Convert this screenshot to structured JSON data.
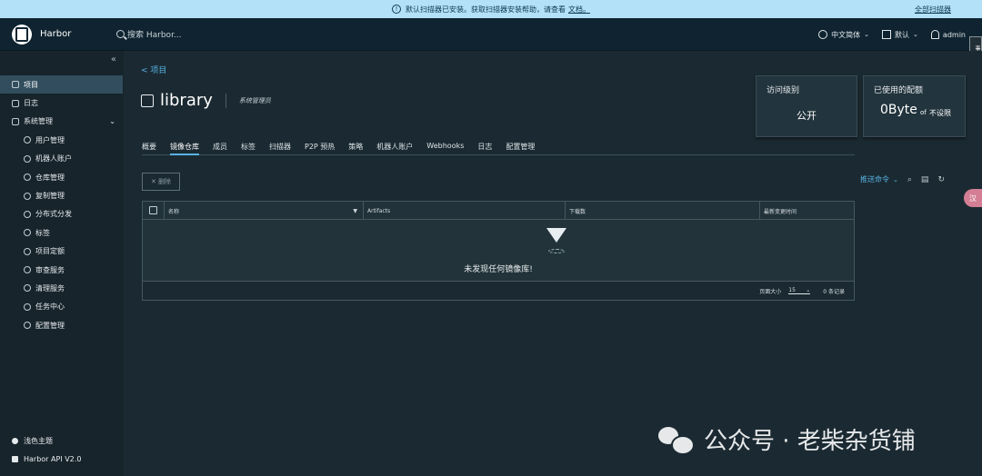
{
  "alert": {
    "text": "默认扫描器已安装。获取扫描器安装帮助，请查看",
    "link": "文档。",
    "action": "全部扫描器"
  },
  "header": {
    "brand": "Harbor",
    "search_placeholder": "搜索 Harbor...",
    "language": "中文简体",
    "datetime": "默认",
    "user": "admin"
  },
  "sidebar": {
    "items": [
      {
        "label": "项目"
      },
      {
        "label": "日志"
      },
      {
        "label": "系统管理"
      }
    ],
    "sub_items": [
      {
        "label": "用户管理"
      },
      {
        "label": "机器人账户"
      },
      {
        "label": "仓库管理"
      },
      {
        "label": "复制管理"
      },
      {
        "label": "分布式分发"
      },
      {
        "label": "标签"
      },
      {
        "label": "项目定额"
      },
      {
        "label": "审查服务"
      },
      {
        "label": "清理服务"
      },
      {
        "label": "任务中心"
      },
      {
        "label": "配置管理"
      }
    ],
    "theme": "浅色主题",
    "api": "Harbor API V2.0"
  },
  "main": {
    "breadcrumb": "< 项目",
    "project_name": "library",
    "role": "系统管理员",
    "access_card": {
      "title": "访问级别",
      "value": "公开"
    },
    "quota_card": {
      "title": "已使用的配额",
      "value": "0Byte",
      "of": "of",
      "limit": "不设限"
    },
    "tabs": [
      "概要",
      "镜像仓库",
      "成员",
      "标签",
      "扫描器",
      "P2P 预热",
      "策略",
      "机器人账户",
      "Webhooks",
      "日志",
      "配置管理"
    ],
    "delete_label": "✕ 删除",
    "push_command": "推送命令",
    "columns": [
      "名称",
      "Artifacts",
      "下载数",
      "最新变更时间"
    ],
    "empty_text": "未发现任何镜像库!",
    "page_size_label": "页面大小",
    "page_size": "15",
    "record_count": "0 条记录"
  },
  "float_tab": "事件日志",
  "float_btn": "汉",
  "watermark": "公众号 · 老柴杂货铺"
}
